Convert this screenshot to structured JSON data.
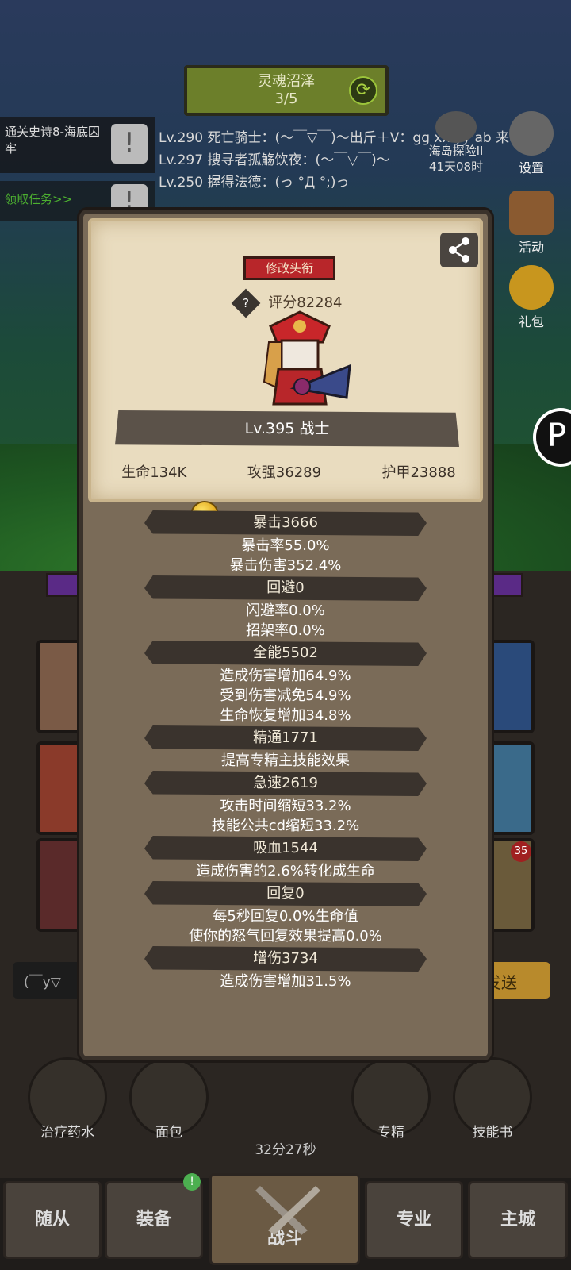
{
  "quest": {
    "title": "灵魂沼泽",
    "progress": "3/5"
  },
  "left_panel": {
    "quest_name": "通关史诗8-海底囚牢",
    "task_link": "领取任务>>"
  },
  "chat": {
    "lines": [
      "Lv.290 死亡骑士：(～￣▽￣)～出斤＋V：gg xx yy ab 来吧",
      "Lv.297 搜寻者孤觞饮夜：(～￣▽￣)～",
      "Lv.250 握得法德：(っ °Д °;)っ"
    ],
    "input_placeholder": "(￣y▽",
    "send_label": "发送"
  },
  "island": {
    "name": "海岛探险II",
    "time": "41天08时"
  },
  "side_buttons": {
    "settings": "设置",
    "activity": "活动",
    "gift": "礼包"
  },
  "panel": {
    "title_button": "修改头衔",
    "score": "评分82284",
    "level_class": "Lv.395 战士",
    "hp": "生命134K",
    "attack": "攻强36289",
    "armor": "护甲23888",
    "attributes": [
      {
        "head": "暴击3666",
        "subs": [
          "暴击率55.0%",
          "暴击伤害352.4%"
        ]
      },
      {
        "head": "回避0",
        "subs": [
          "闪避率0.0%",
          "招架率0.0%"
        ]
      },
      {
        "head": "全能5502",
        "subs": [
          "造成伤害增加64.9%",
          "受到伤害减免54.9%",
          "生命恢复增加34.8%"
        ]
      },
      {
        "head": "精通1771",
        "subs": [
          "提高专精主技能效果"
        ]
      },
      {
        "head": "急速2619",
        "subs": [
          "攻击时间缩短33.2%",
          "技能公共cd缩短33.2%"
        ]
      },
      {
        "head": "吸血1544",
        "subs": [
          "造成伤害的2.6%转化成生命"
        ]
      },
      {
        "head": "回复0",
        "subs": [
          "每5秒回复0.0%生命值",
          "使你的怒气回复效果提高0.0%"
        ]
      },
      {
        "head": "增伤3734",
        "subs": [
          "造成伤害增加31.5%"
        ]
      }
    ]
  },
  "items": {
    "potion": "治疗药水",
    "bread": "面包",
    "specialty": "专精",
    "skill_book": "技能书",
    "timer": "32分27秒"
  },
  "nav": {
    "followers": "随从",
    "equipment": "装备",
    "battle": "战斗",
    "profession": "专业",
    "city": "主城",
    "badge": "!"
  },
  "slot_badge": "35",
  "colors": {
    "accent_red": "#b8262a",
    "panel_bg": "#7a6b58",
    "card_bg": "#e9dcbf",
    "quest_green": "#6c7f2a"
  }
}
